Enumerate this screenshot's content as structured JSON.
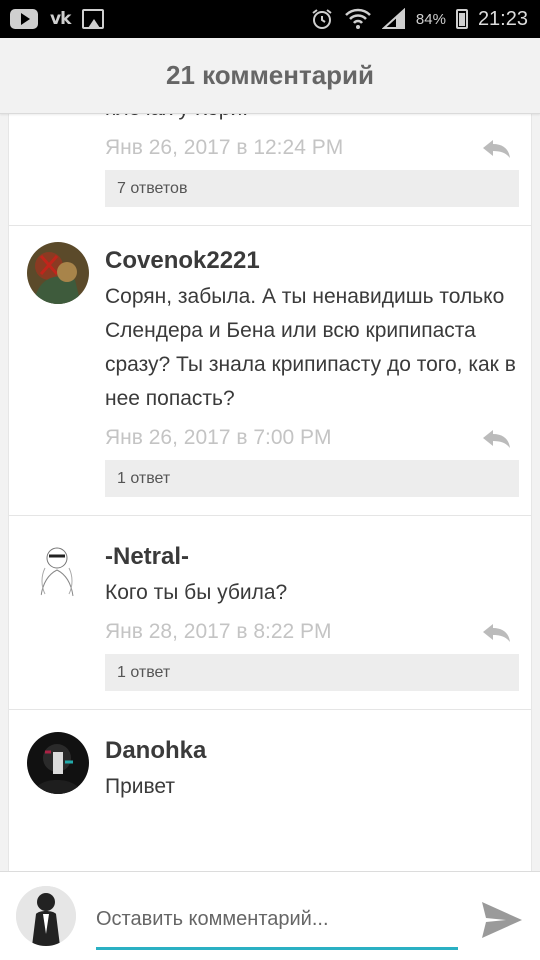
{
  "status_bar": {
    "battery": "84%",
    "time": "21:23",
    "vk_label": "vk"
  },
  "header": {
    "title": "21 комментарий"
  },
  "comments": [
    {
      "author": "",
      "text": "плечах у Кори.",
      "date": "Янв 26, 2017 в 12:24 PM",
      "replies": "7 ответов",
      "avatar_icon": "none"
    },
    {
      "author": "Covenok2221",
      "text": "Сорян, забыла. А ты ненавидишь только Слендера и Бена или всю крипипаста сразу? Ты знала крипипасту до того, как в нее попасть?",
      "date": "Янв 26, 2017 в 7:00 PM",
      "replies": "1 ответ",
      "avatar_icon": "anime-avatar"
    },
    {
      "author": "-Netral-",
      "text": "Кого ты бы убила?",
      "date": "Янв 28, 2017 в 8:22 PM",
      "replies": "1 ответ",
      "avatar_icon": "sketch-avatar"
    },
    {
      "author": "Danohka",
      "text": "Привет",
      "date": "",
      "replies": "",
      "avatar_icon": "dark-avatar"
    }
  ],
  "composer": {
    "placeholder": "Оставить комментарий..."
  },
  "icons": {
    "reply": "reply-icon",
    "send": "send-icon"
  },
  "colors": {
    "accent": "#2ab0c3",
    "date_text": "#c4c4c4",
    "reply_bar": "#ededed"
  }
}
